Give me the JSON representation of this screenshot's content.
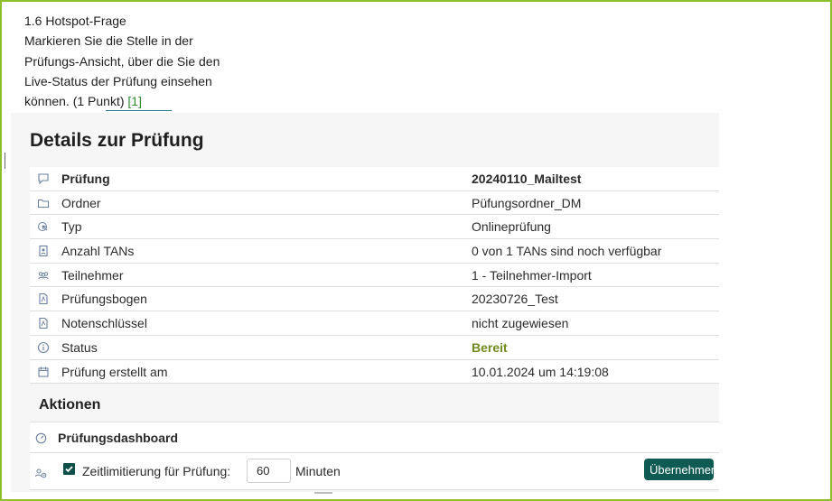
{
  "question": {
    "line1": "1.6 Hotspot-Frage",
    "line2": "Markieren Sie die Stelle in der",
    "line3": "Prüfungs-Ansicht, über die Sie den",
    "line4": "Live-Status der Prüfung einsehen",
    "line5": "können. (1 Punkt)",
    "reference": "[1]"
  },
  "details": {
    "title": "Details zur Prüfung",
    "rows": [
      {
        "icon": "speech-bubble-icon",
        "label": "Prüfung",
        "value": "20240110_Mailtest"
      },
      {
        "icon": "folder-icon",
        "label": "Ordner",
        "value": "Püfungsordner_DM"
      },
      {
        "icon": "cursor-pointer-icon",
        "label": "Typ",
        "value": "Onlineprüfung"
      },
      {
        "icon": "id-card-icon",
        "label": "Anzahl TANs",
        "value": "0 von 1 TANs sind noch verfügbar"
      },
      {
        "icon": "group-icon",
        "label": "Teilnehmer",
        "value": "1 - Teilnehmer-Import"
      },
      {
        "icon": "pdf-document-icon",
        "label": "Prüfungsbogen",
        "value": "20230726_Test"
      },
      {
        "icon": "pdf-document-icon",
        "label": "Notenschlüssel",
        "value": "nicht zugewiesen"
      },
      {
        "icon": "info-circle-icon",
        "label": "Status",
        "value": "Bereit"
      },
      {
        "icon": "calendar-icon",
        "label": "Prüfung erstellt am",
        "value": "10.01.2024 um 14:19:08"
      }
    ]
  },
  "actions": {
    "title": "Aktionen",
    "dashboard_label": "Prüfungsdashboard",
    "time_limit_label": "Zeitlimitierung für Prüfung:",
    "time_limit_value": "60",
    "time_limit_unit": "Minuten",
    "apply_label": "Übernehmen"
  },
  "colors": {
    "frame": "#8cbf2a",
    "status_ready": "#6f8a1e",
    "primary_button": "#0f5a52",
    "reference_link": "#2e8b30"
  }
}
